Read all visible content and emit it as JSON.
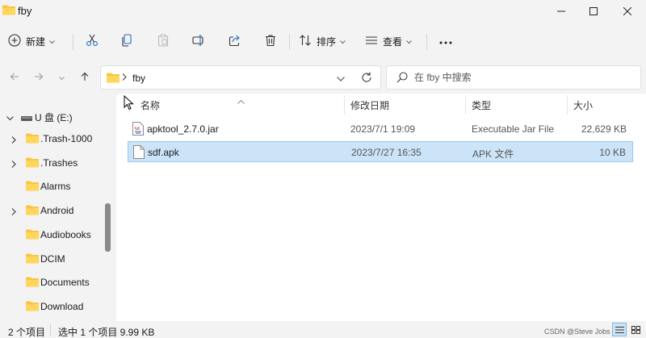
{
  "window": {
    "title": "fby"
  },
  "toolbar": {
    "new_label": "新建",
    "sort_label": "排序",
    "view_label": "查看"
  },
  "address": {
    "crumb": "fby",
    "search_placeholder": "在 fby 中搜索"
  },
  "sidebar": {
    "drive": "U 盘 (E:)",
    "items": [
      {
        "label": ".Trash-1000",
        "expandable": true
      },
      {
        "label": ".Trashes",
        "expandable": true
      },
      {
        "label": "Alarms",
        "expandable": false
      },
      {
        "label": "Android",
        "expandable": true
      },
      {
        "label": "Audiobooks",
        "expandable": false
      },
      {
        "label": "DCIM",
        "expandable": false
      },
      {
        "label": "Documents",
        "expandable": false
      },
      {
        "label": "Download",
        "expandable": false
      }
    ]
  },
  "columns": {
    "name": "名称",
    "date": "修改日期",
    "type": "类型",
    "size": "大小"
  },
  "files": [
    {
      "name": "apktool_2.7.0.jar",
      "date": "2023/7/1 19:09",
      "type": "Executable Jar File",
      "size": "22,629 KB",
      "icon": "jar-file-icon",
      "selected": false
    },
    {
      "name": "sdf.apk",
      "date": "2023/7/27 16:35",
      "type": "APK 文件",
      "size": "10 KB",
      "icon": "blank-file-icon",
      "selected": true
    }
  ],
  "status": {
    "count": "2 个项目",
    "selection": "选中 1 个项目  9.99 KB"
  },
  "watermark": "CSDN @Steve Jobs 精神",
  "colors": {
    "folder": "#f8c740",
    "selection": "#cce4f7",
    "selection_border": "#99c9ef"
  }
}
